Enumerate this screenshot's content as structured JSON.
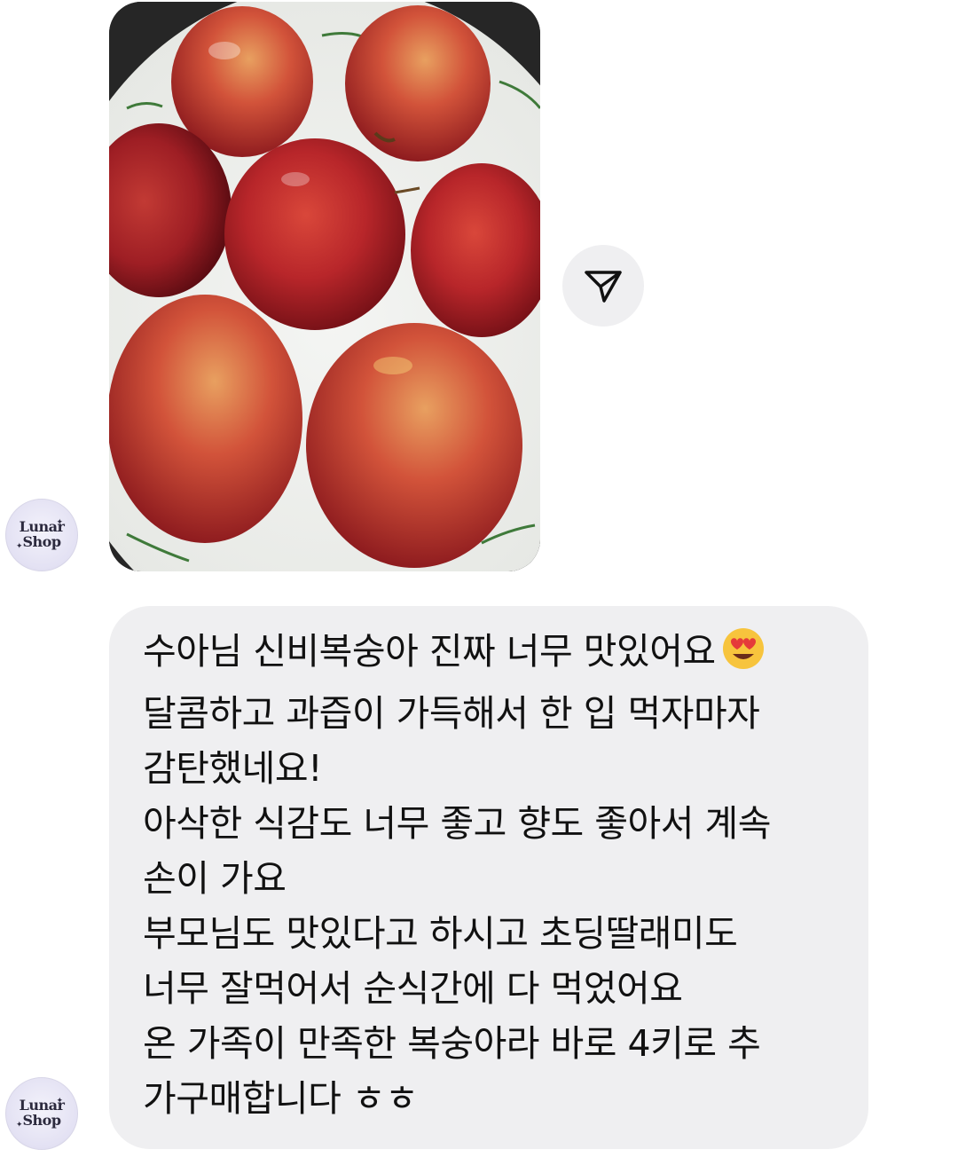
{
  "conversation": {
    "photo_message": {
      "alt": "",
      "share_icon": "send-icon"
    },
    "avatar": {
      "line1": "Lunar",
      "line2": "Shop"
    },
    "text_message": {
      "lines": [
        "수아님 신비복숭아 진짜 너무 맛있어요",
        "달콤하고 과즙이 가득해서 한 입 먹자마자",
        "감탄했네요!",
        "아삭한 식감도 너무 좋고 향도 좋아서 계속",
        "손이 가요",
        "부모님도 맛있다고 하시고 초딩딸래미도",
        "너무 잘먹어서 순식간에 다 먹었어요",
        "온 가족이 만족한 복숭아라 바로 4키로 추",
        "가구매합니다 ㅎㅎ"
      ],
      "emoji": "smiling-face-with-heart-eyes"
    }
  },
  "colors": {
    "bubble_bg": "#efeff1",
    "text": "#111111",
    "page_bg": "#ffffff"
  }
}
